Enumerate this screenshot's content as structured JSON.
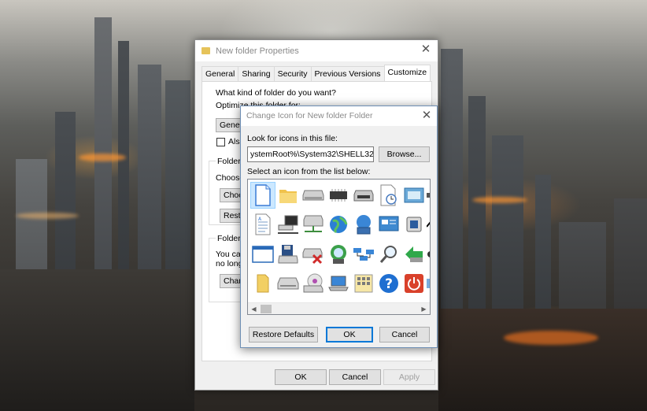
{
  "properties_window": {
    "title": "New folder Properties",
    "tabs": [
      "General",
      "Sharing",
      "Security",
      "Previous Versions",
      "Customize"
    ],
    "active_tab": "Customize",
    "customize": {
      "question": "What kind of folder do you want?",
      "optimize_label": "Optimize this folder for:",
      "optimize_value": "Genera",
      "also_apply_label": "Also",
      "folder_pictures_label": "Folder p",
      "choose_label": "Choose",
      "choose_file_button": "Choo",
      "restore_default_button": "Resto",
      "folder_icons_label": "Folder ic",
      "change_text_1": "You can",
      "change_text_2": "no longe",
      "change_icon_button": "Chan"
    },
    "buttons": {
      "ok": "OK",
      "cancel": "Cancel",
      "apply": "Apply"
    }
  },
  "change_icon_dialog": {
    "title": "Change Icon for New folder Folder",
    "look_for_label": "Look for icons in this file:",
    "path_value": "ystemRoot%\\System32\\SHELL32.dll",
    "browse_button": "Browse...",
    "select_label": "Select an icon from the list below:",
    "icons": [
      [
        "blank-document-icon",
        "folder-icon",
        "drive-icon",
        "chip-icon",
        "printer-drive-icon",
        "clock-document-icon",
        "control-panel-icon",
        "partial-icon"
      ],
      [
        "text-document-icon",
        "network-computer-icon",
        "network-drive-icon",
        "globe-icon",
        "network-globe-icon",
        "monitor-window-icon",
        "system-icon",
        "shortcut-icon"
      ],
      [
        "window-icon",
        "floppy-drive-icon",
        "drive-error-icon",
        "network-cd-icon",
        "network-link-icon",
        "magnifier-icon",
        "arrow-icon",
        "partial-icon"
      ],
      [
        "folder-small-icon",
        "hard-drive-icon",
        "cd-drive-icon",
        "laptop-icon",
        "control-grid-icon",
        "help-icon",
        "power-icon",
        "partial-icon"
      ]
    ],
    "buttons": {
      "restore_defaults": "Restore Defaults",
      "ok": "OK",
      "cancel": "Cancel"
    }
  },
  "colors": {
    "accent": "#0078d7",
    "selection": "#cce8ff",
    "folder": "#e6c35a"
  }
}
